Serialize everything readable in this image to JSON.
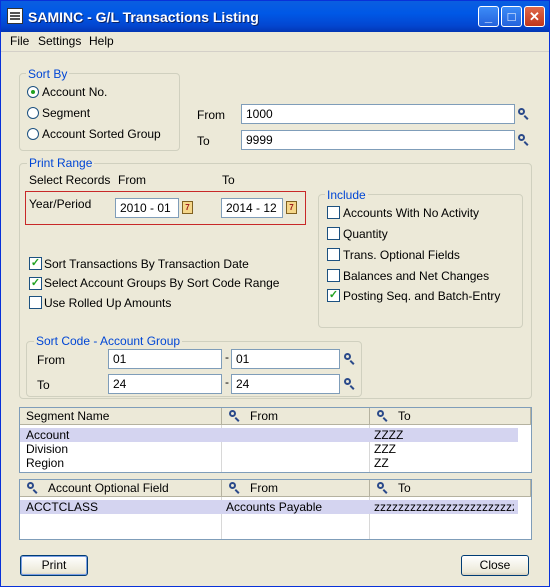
{
  "window": {
    "title": "SAMINC - G/L Transactions Listing"
  },
  "menu": {
    "file": "File",
    "settings": "Settings",
    "help": "Help"
  },
  "sort_by": {
    "label": "Sort By",
    "options": [
      "Account No.",
      "Segment",
      "Account Sorted Group"
    ],
    "selected": "Account No.",
    "from_label": "From",
    "to_label": "To",
    "from_value": "1000",
    "to_value": "9999"
  },
  "print_range": {
    "label": "Print Range",
    "select_records": "Select Records",
    "from_header": "From",
    "to_header": "To",
    "year_period_label": "Year/Period",
    "from_value": "2010 - 01",
    "to_value": "2014 - 12"
  },
  "options": [
    {
      "label": "Sort Transactions By Transaction Date",
      "checked": true
    },
    {
      "label": "Select Account Groups By Sort Code Range",
      "checked": true
    },
    {
      "label": "Use Rolled Up Amounts",
      "checked": false
    }
  ],
  "include": {
    "label": "Include",
    "items": [
      {
        "label": "Accounts With No Activity",
        "checked": false
      },
      {
        "label": "Quantity",
        "checked": false
      },
      {
        "label": "Trans. Optional Fields",
        "checked": false
      },
      {
        "label": "Balances and Net Changes",
        "checked": false
      },
      {
        "label": "Posting Seq. and Batch-Entry",
        "checked": true
      }
    ]
  },
  "sort_code": {
    "label": "Sort Code - Account Group",
    "from_label": "From",
    "to_label": "To",
    "from1": "01",
    "from2": "01",
    "to1": "24",
    "to2": "24",
    "separator": "-"
  },
  "segment_grid": {
    "headers": [
      "Segment Name",
      "From",
      "To"
    ],
    "rows": [
      {
        "name": "Account",
        "from": "",
        "to": "ZZZZ"
      },
      {
        "name": "Division",
        "from": "",
        "to": "ZZZ"
      },
      {
        "name": "Region",
        "from": "",
        "to": "ZZ"
      }
    ]
  },
  "optional_grid": {
    "headers": [
      "Account Optional Field",
      "From",
      "To"
    ],
    "rows": [
      {
        "field": "ACCTCLASS",
        "from": "Accounts Payable",
        "to": "zzzzzzzzzzzzzzzzzzzzzzzz..."
      }
    ]
  },
  "buttons": {
    "print": "Print",
    "close": "Close"
  },
  "colors": {
    "title_bar": "#0058e6",
    "group_label": "#0046d5",
    "highlight_box": "#c82828",
    "selected_row": "#d4d4f0"
  }
}
